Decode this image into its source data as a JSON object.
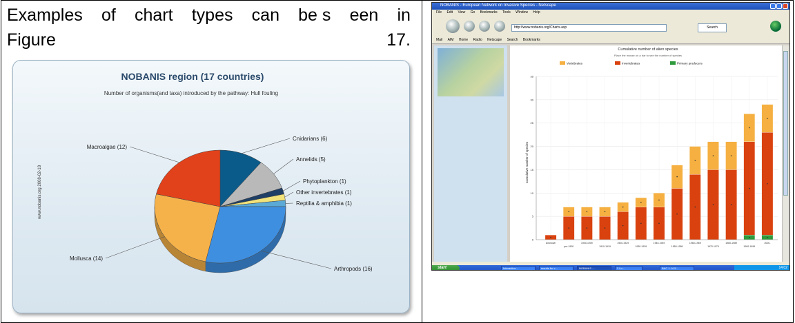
{
  "intro": {
    "line1_words": [
      "Examples",
      "of",
      "chart",
      "types",
      "can",
      "be s",
      "een",
      "in"
    ],
    "line2_left": "Figure",
    "line2_right": "17."
  },
  "pie": {
    "title": "NOBANIS region (17 countries)",
    "subtitle": "Number of organisms(and taxa) introduced by the pathway: Hull fouling",
    "watermark": "www.nobanis.org 2008-02-18",
    "colors": {
      "cnidarians": "#0b5b8a",
      "annelids": "#b9b9b9",
      "phytoplankton": "#1f3f66",
      "other": "#f2e27a",
      "reptilia": "#5aa9d6",
      "arthropods": "#3f8fe0",
      "mollusca": "#f6b24a",
      "macroalgae": "#e2421b"
    }
  },
  "chart_data": [
    {
      "type": "pie",
      "title": "NOBANIS region (17 countries)",
      "subtitle": "Number of organisms(and taxa) introduced by the pathway: Hull fouling",
      "slices": [
        {
          "label": "Cnidarians (6)",
          "value": 6
        },
        {
          "label": "Annelids (5)",
          "value": 5
        },
        {
          "label": "Phytoplankton (1)",
          "value": 1
        },
        {
          "label": "Other invertebrates (1)",
          "value": 1
        },
        {
          "label": "Reptilia & amphibia (1)",
          "value": 1
        },
        {
          "label": "Arthropods (16)",
          "value": 16
        },
        {
          "label": "Mollusca (14)",
          "value": 14
        },
        {
          "label": "Macroalgae (12)",
          "value": 12
        }
      ]
    },
    {
      "type": "bar",
      "stacked": true,
      "title": "Cumulative number of alien species",
      "ylabel": "Cumulative number of species",
      "ylim": [
        0,
        35
      ],
      "yticks": [
        0,
        5,
        10,
        15,
        20,
        25,
        30,
        35
      ],
      "xtick_labels": [
        "Unknown",
        "",
        "1900-1909",
        "",
        "1920-1929",
        "",
        "1940-1949",
        "",
        "1960-1969",
        "",
        "1980-1989",
        "",
        "2000-"
      ],
      "xtick_labels_alt": [
        "",
        "pre-1900",
        "",
        "1910-1919",
        "",
        "1930-1939",
        "",
        "1950-1959",
        "",
        "1970-1979",
        "",
        "1990-1999",
        ""
      ],
      "legend": [
        "Vertebrates",
        "Invertebrates",
        "Primary producers"
      ],
      "legend_position": "top",
      "series": [
        {
          "name": "Vertebrates",
          "color": "#f5b041",
          "values": [
            0,
            2,
            2,
            2,
            2,
            2,
            3,
            5,
            6,
            6,
            6,
            6,
            6
          ]
        },
        {
          "name": "Invertebrates",
          "color": "#d9420f",
          "values": [
            1,
            5,
            5,
            5,
            6,
            7,
            7,
            11,
            14,
            15,
            15,
            20,
            22
          ]
        },
        {
          "name": "Primary producers",
          "color": "#2e9a3b",
          "values": [
            0,
            0,
            0,
            0,
            0,
            0,
            0,
            0,
            0,
            0,
            0,
            1,
            1
          ]
        }
      ]
    }
  ],
  "browser": {
    "window_title": "NOBANIS - European Network on Invasive Species - Netscape",
    "menu_items": [
      "File",
      "Edit",
      "View",
      "Go",
      "Bookmarks",
      "Tools",
      "Window",
      "Help"
    ],
    "url": "http://www.nobanis.org/Charts.asp",
    "search_button": "Search",
    "bookmarks": [
      "Mail",
      "AIM",
      "Home",
      "Radio",
      "Netscape",
      "Search",
      "Bookmarks"
    ],
    "content_title": "Cumulative number of alien species",
    "content_subtitle": "Place the mouse on a bar to see the number of species",
    "start_label": "start",
    "task_buttons": [
      "Interactive...",
      "results for c...",
      "NOBANIS -...",
      "2 Lo...",
      "BAC 1.14 5..."
    ],
    "tray_time": "14:02"
  }
}
